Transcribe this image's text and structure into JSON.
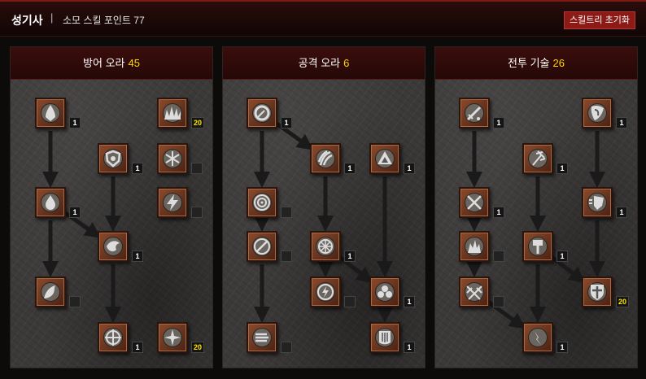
{
  "header": {
    "class_name": "성기사",
    "separator": "|",
    "points_text": "소모 스킬 포인트 77",
    "reset_label": "스킬트리 초기화"
  },
  "trees": [
    {
      "title": "방어 오라",
      "count": "45",
      "skills": [
        {
          "icon": "flame-shield-icon",
          "rank": "1"
        },
        {
          "icon": "spiky-aura-icon",
          "rank": "20"
        },
        {
          "icon": "shield-swirl-icon",
          "rank": "1"
        },
        {
          "icon": "snowflake-icon",
          "rank": ""
        },
        {
          "icon": "fire-drop-icon",
          "rank": "1"
        },
        {
          "icon": "lightning-bolt-icon",
          "rank": ""
        },
        {
          "icon": "phoenix-icon",
          "rank": "1"
        },
        {
          "icon": "wing-flame-icon",
          "rank": ""
        },
        {
          "icon": "crosshair-icon",
          "rank": "1"
        },
        {
          "icon": "holy-cross-icon",
          "rank": "20"
        }
      ]
    },
    {
      "title": "공격 오라",
      "count": "6",
      "skills": [
        {
          "icon": "target-ring-icon",
          "rank": "1"
        },
        {
          "icon": "claw-icon",
          "rank": "1"
        },
        {
          "icon": "up-arrow-icon",
          "rank": "1"
        },
        {
          "icon": "concentric-circle-icon",
          "rank": ""
        },
        {
          "icon": "slash-icon",
          "rank": ""
        },
        {
          "icon": "sun-wheel-icon",
          "rank": "1"
        },
        {
          "icon": "lightning-orb-icon",
          "rank": ""
        },
        {
          "icon": "trinity-icon",
          "rank": "1"
        },
        {
          "icon": "meteor-icon",
          "rank": ""
        },
        {
          "icon": "barrier-icon",
          "rank": "1"
        }
      ]
    },
    {
      "title": "전투 기술",
      "count": "26",
      "skills": [
        {
          "icon": "sword-drops-icon",
          "rank": "1"
        },
        {
          "icon": "shield-swoosh-icon",
          "rank": "1"
        },
        {
          "icon": "hammer-burst-icon",
          "rank": "1"
        },
        {
          "icon": "crossed-swords-icon",
          "rank": "1"
        },
        {
          "icon": "charging-shield-icon",
          "rank": "1"
        },
        {
          "icon": "shattered-icon",
          "rank": ""
        },
        {
          "icon": "war-hammer-icon",
          "rank": "1"
        },
        {
          "icon": "crossed-blades-icon",
          "rank": ""
        },
        {
          "icon": "knight-shield-icon",
          "rank": "20"
        },
        {
          "icon": "fist-strike-icon",
          "rank": "1"
        }
      ]
    }
  ]
}
